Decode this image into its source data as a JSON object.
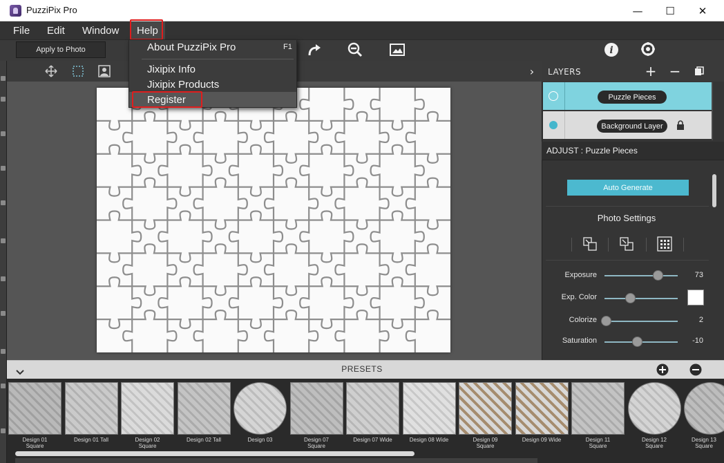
{
  "window": {
    "title": "PuzziPix Pro",
    "minimize": "—",
    "maximize": "☐",
    "close": "✕"
  },
  "menubar": {
    "file": "File",
    "edit": "Edit",
    "window": "Window",
    "help": "Help"
  },
  "help_menu": {
    "about": "About PuzziPix Pro",
    "about_shortcut": "F1",
    "info": "Jixipix Info",
    "products": "Jixipix Products",
    "register": "Register"
  },
  "toolbar": {
    "apply_label": "Apply to Photo"
  },
  "layers": {
    "title": "LAYERS",
    "add": "+",
    "remove": "−",
    "items": [
      {
        "label": "Puzzle Pieces"
      },
      {
        "label": "Background Layer"
      }
    ]
  },
  "adjust": {
    "title": "ADJUST : Puzzle Pieces",
    "auto_generate": "Auto Generate",
    "photo_settings": "Photo Settings",
    "sliders": [
      {
        "label": "Exposure",
        "value": "73",
        "level": 0.73
      },
      {
        "label": "Exp. Color",
        "value": "",
        "level": 0.35
      },
      {
        "label": "Colorize",
        "value": "2",
        "level": 0.02
      },
      {
        "label": "Saturation",
        "value": "-10",
        "level": 0.45
      }
    ]
  },
  "presets": {
    "title": "PRESETS",
    "items": [
      {
        "line1": "Design 01",
        "line2": "Square"
      },
      {
        "line1": "Design 01 Tall",
        "line2": ""
      },
      {
        "line1": "Design 02",
        "line2": "Square"
      },
      {
        "line1": "Design 02 Tall",
        "line2": ""
      },
      {
        "line1": "Design 03",
        "line2": ""
      },
      {
        "line1": "Design 07",
        "line2": "Square"
      },
      {
        "line1": "Design 07 Wide",
        "line2": ""
      },
      {
        "line1": "Design 08 Wide",
        "line2": ""
      },
      {
        "line1": "Design 09",
        "line2": "Square"
      },
      {
        "line1": "Design 09 Wide",
        "line2": ""
      },
      {
        "line1": "Design 11",
        "line2": "Square"
      },
      {
        "line1": "Design 12",
        "line2": "Square"
      },
      {
        "line1": "Design 13",
        "line2": "Square"
      }
    ]
  },
  "colors": {
    "accent": "#4cb9cf",
    "highlight_box": "#e01d1d",
    "layer_selected": "#7fd3df"
  }
}
